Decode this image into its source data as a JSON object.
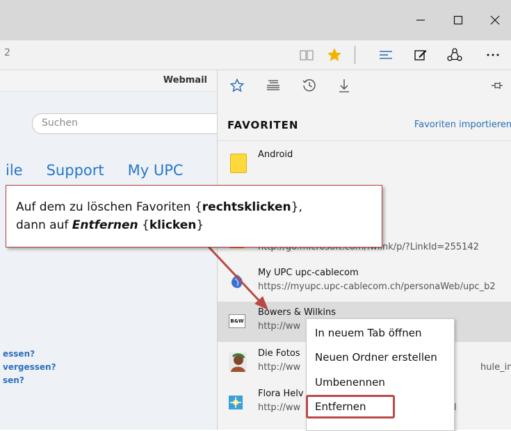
{
  "toolbar": {
    "address_fragment": "2"
  },
  "webpage": {
    "topbar_link": "Webmail",
    "search_placeholder": "Suchen",
    "nav_links": [
      "ile",
      "Support",
      "My UPC"
    ],
    "forgot_links": [
      "essen?",
      "vergessen?",
      "sen?"
    ]
  },
  "hub": {
    "heading": "FAVORITEN",
    "import_link": "Favoriten importieren",
    "items": [
      {
        "title": "Android",
        "url": ""
      },
      {
        "title": "",
        "url": "http://go.microsoft.com/fwlink/p/?LinkId=255142"
      },
      {
        "title": "My UPC  upc-cablecom",
        "url": "https://myupc.upc-cablecom.ch/personaWeb/upc_b2"
      },
      {
        "title": "Bowers & Wilkins",
        "url": "http://ww",
        "icon_text": "B&W"
      },
      {
        "title": "Die Fotos",
        "url": "http://ww",
        "url_tail": "hule_inhalt"
      },
      {
        "title": "Flora Helv",
        "url": "http://ww",
        "url_tail": "l"
      }
    ]
  },
  "callout": {
    "line1_prefix": "Auf dem zu löschen Favoriten {",
    "line1_bold": "rechtsklicken",
    "line1_suffix": "},",
    "line2_prefix": "dann auf ",
    "line2_bold_italic": "Entfernen",
    "line2_mid": " {",
    "line2_bold": "klicken",
    "line2_suffix": "}"
  },
  "context_menu": {
    "items": [
      "In neuem Tab öffnen",
      "Neuen Ordner erstellen",
      "Umbenennen",
      "Entfernen"
    ]
  },
  "colors": {
    "accent": "#2a6fb8",
    "callout_border": "#b53a32",
    "highlight_border": "#b94a48",
    "star": "#f5b301"
  }
}
